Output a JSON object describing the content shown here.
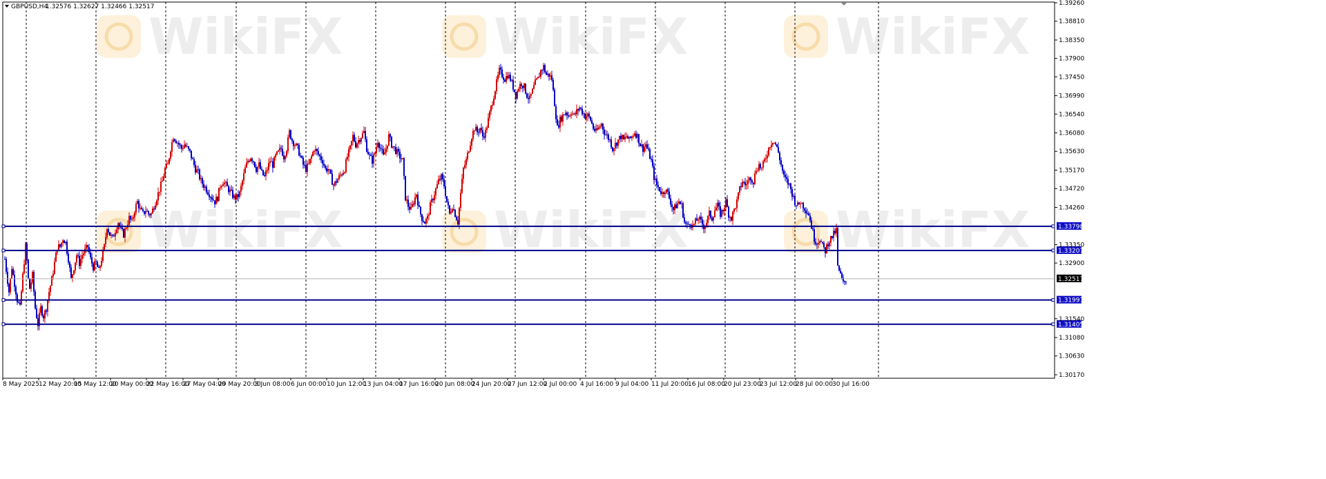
{
  "header": {
    "symbol_label": "GBPUSD,H4",
    "ohlc": "1.32576 1.32627 1.32466 1.32517"
  },
  "watermark": {
    "text": "WikiFX"
  },
  "colors": {
    "background": "#ffffff",
    "bull_candle": "#d40000",
    "bear_candle": "#0000c8",
    "level_line": "#00008b",
    "grid": "#000000",
    "current_price_tag": "#000000"
  },
  "chart_data": {
    "type": "candlestick",
    "symbol": "GBPUSD",
    "timeframe": "H4",
    "ylim": [
      1.3017,
      1.3926
    ],
    "price_ticks": [
      "1.39260",
      "1.38810",
      "1.38350",
      "1.37900",
      "1.37450",
      "1.36990",
      "1.36540",
      "1.36080",
      "1.35630",
      "1.35170",
      "1.34720",
      "1.34260",
      "1.33350",
      "1.32900",
      "1.31540",
      "1.31080",
      "1.30630",
      "1.30170"
    ],
    "time_labels": [
      "8 May 2025",
      "12 May 20:00",
      "15 May 12:00",
      "20 May 00:00",
      "22 May 16:00",
      "27 May 04:00",
      "29 May 20:00",
      "3 Jun 08:00",
      "6 Jun 00:00",
      "10 Jun 12:00",
      "13 Jun 04:00",
      "17 Jun 16:00",
      "20 Jun 08:00",
      "24 Jun 20:00",
      "27 Jun 12:00",
      "2 Jul 00:00",
      "4 Jul 16:00",
      "9 Jul 04:00",
      "11 Jul 20:00",
      "16 Jul 08:00",
      "20 Jul 23:00",
      "23 Jul 12:00",
      "28 Jul 00:00",
      "30 Jul 16:00"
    ],
    "horizontal_levels": [
      {
        "value": 1.33798,
        "label": "1.33798"
      },
      {
        "value": 1.33207,
        "label": "1.33207"
      },
      {
        "value": 1.31997,
        "label": "1.31997"
      },
      {
        "value": 1.31405,
        "label": "1.31405"
      }
    ],
    "current_price": {
      "value": 1.32517,
      "label": "1.32517"
    },
    "close_path": [
      [
        0,
        1.33
      ],
      [
        6,
        1.322
      ],
      [
        10,
        1.328
      ],
      [
        14,
        1.324
      ],
      [
        18,
        1.32
      ],
      [
        22,
        1.318
      ],
      [
        26,
        1.326
      ],
      [
        30,
        1.333
      ],
      [
        33,
        1.328
      ],
      [
        35,
        1.322
      ],
      [
        40,
        1.326
      ],
      [
        44,
        1.318
      ],
      [
        48,
        1.314
      ],
      [
        52,
        1.318
      ],
      [
        56,
        1.316
      ],
      [
        60,
        1.318
      ],
      [
        64,
        1.322
      ],
      [
        68,
        1.325
      ],
      [
        72,
        1.329
      ],
      [
        76,
        1.333
      ],
      [
        80,
        1.333
      ],
      [
        84,
        1.335
      ],
      [
        88,
        1.334
      ],
      [
        92,
        1.33
      ],
      [
        96,
        1.325
      ],
      [
        100,
        1.328
      ],
      [
        104,
        1.331
      ],
      [
        108,
        1.329
      ],
      [
        112,
        1.331
      ],
      [
        116,
        1.332
      ],
      [
        120,
        1.333
      ],
      [
        124,
        1.33
      ],
      [
        128,
        1.328
      ],
      [
        132,
        1.329
      ],
      [
        136,
        1.327
      ],
      [
        140,
        1.33
      ],
      [
        144,
        1.333
      ],
      [
        148,
        1.338
      ],
      [
        152,
        1.336
      ],
      [
        156,
        1.335
      ],
      [
        160,
        1.337
      ],
      [
        164,
        1.339
      ],
      [
        168,
        1.337
      ],
      [
        172,
        1.336
      ],
      [
        176,
        1.338
      ],
      [
        180,
        1.34
      ],
      [
        184,
        1.339
      ],
      [
        188,
        1.342
      ],
      [
        192,
        1.344
      ],
      [
        196,
        1.342
      ],
      [
        200,
        1.341
      ],
      [
        204,
        1.342
      ],
      [
        208,
        1.341
      ],
      [
        212,
        1.341
      ],
      [
        216,
        1.343
      ],
      [
        220,
        1.345
      ],
      [
        224,
        1.347
      ],
      [
        228,
        1.349
      ],
      [
        232,
        1.352
      ],
      [
        236,
        1.353
      ],
      [
        240,
        1.357
      ],
      [
        244,
        1.36
      ],
      [
        248,
        1.359
      ],
      [
        252,
        1.358
      ],
      [
        256,
        1.357
      ],
      [
        260,
        1.358
      ],
      [
        264,
        1.357
      ],
      [
        268,
        1.356
      ],
      [
        272,
        1.354
      ],
      [
        276,
        1.352
      ],
      [
        280,
        1.351
      ],
      [
        284,
        1.349
      ],
      [
        288,
        1.348
      ],
      [
        292,
        1.347
      ],
      [
        296,
        1.346
      ],
      [
        300,
        1.345
      ],
      [
        304,
        1.344
      ],
      [
        308,
        1.345
      ],
      [
        312,
        1.348
      ],
      [
        316,
        1.349
      ],
      [
        320,
        1.348
      ],
      [
        324,
        1.347
      ],
      [
        328,
        1.346
      ],
      [
        332,
        1.345
      ],
      [
        336,
        1.345
      ],
      [
        340,
        1.346
      ],
      [
        344,
        1.349
      ],
      [
        348,
        1.352
      ],
      [
        352,
        1.354
      ],
      [
        356,
        1.355
      ],
      [
        360,
        1.354
      ],
      [
        364,
        1.352
      ],
      [
        368,
        1.353
      ],
      [
        372,
        1.351
      ],
      [
        376,
        1.35
      ],
      [
        380,
        1.352
      ],
      [
        384,
        1.354
      ],
      [
        388,
        1.353
      ],
      [
        392,
        1.355
      ],
      [
        396,
        1.356
      ],
      [
        400,
        1.357
      ],
      [
        404,
        1.355
      ],
      [
        408,
        1.357
      ],
      [
        412,
        1.361
      ],
      [
        416,
        1.359
      ],
      [
        420,
        1.358
      ],
      [
        424,
        1.357
      ],
      [
        428,
        1.355
      ],
      [
        432,
        1.353
      ],
      [
        436,
        1.352
      ],
      [
        440,
        1.353
      ],
      [
        444,
        1.355
      ],
      [
        448,
        1.357
      ],
      [
        452,
        1.356
      ],
      [
        456,
        1.355
      ],
      [
        460,
        1.354
      ],
      [
        464,
        1.352
      ],
      [
        468,
        1.352
      ],
      [
        472,
        1.35
      ],
      [
        476,
        1.348
      ],
      [
        480,
        1.349
      ],
      [
        484,
        1.35
      ],
      [
        488,
        1.351
      ],
      [
        492,
        1.352
      ],
      [
        496,
        1.355
      ],
      [
        500,
        1.357
      ],
      [
        504,
        1.36
      ],
      [
        508,
        1.358
      ],
      [
        512,
        1.359
      ],
      [
        516,
        1.36
      ],
      [
        520,
        1.361
      ],
      [
        524,
        1.357
      ],
      [
        528,
        1.355
      ],
      [
        532,
        1.354
      ],
      [
        536,
        1.356
      ],
      [
        540,
        1.359
      ],
      [
        544,
        1.357
      ],
      [
        548,
        1.355
      ],
      [
        552,
        1.357
      ],
      [
        556,
        1.36
      ],
      [
        560,
        1.358
      ],
      [
        564,
        1.357
      ],
      [
        568,
        1.356
      ],
      [
        572,
        1.355
      ],
      [
        576,
        1.354
      ],
      [
        580,
        1.345
      ],
      [
        584,
        1.343
      ],
      [
        588,
        1.342
      ],
      [
        592,
        1.344
      ],
      [
        596,
        1.346
      ],
      [
        600,
        1.342
      ],
      [
        604,
        1.34
      ],
      [
        608,
        1.339
      ],
      [
        612,
        1.34
      ],
      [
        616,
        1.343
      ],
      [
        620,
        1.345
      ],
      [
        624,
        1.347
      ],
      [
        628,
        1.349
      ],
      [
        632,
        1.35
      ],
      [
        636,
        1.348
      ],
      [
        640,
        1.344
      ],
      [
        644,
        1.341
      ],
      [
        648,
        1.343
      ],
      [
        652,
        1.341
      ],
      [
        656,
        1.339
      ],
      [
        660,
        1.346
      ],
      [
        664,
        1.352
      ],
      [
        668,
        1.354
      ],
      [
        672,
        1.357
      ],
      [
        676,
        1.36
      ],
      [
        680,
        1.362
      ],
      [
        684,
        1.361
      ],
      [
        688,
        1.362
      ],
      [
        692,
        1.36
      ],
      [
        696,
        1.361
      ],
      [
        700,
        1.364
      ],
      [
        704,
        1.367
      ],
      [
        708,
        1.37
      ],
      [
        712,
        1.373
      ],
      [
        716,
        1.376
      ],
      [
        720,
        1.375
      ],
      [
        724,
        1.374
      ],
      [
        728,
        1.375
      ],
      [
        732,
        1.374
      ],
      [
        736,
        1.372
      ],
      [
        740,
        1.37
      ],
      [
        744,
        1.372
      ],
      [
        748,
        1.373
      ],
      [
        752,
        1.372
      ],
      [
        756,
        1.37
      ],
      [
        760,
        1.369
      ],
      [
        764,
        1.371
      ],
      [
        768,
        1.373
      ],
      [
        772,
        1.374
      ],
      [
        776,
        1.376
      ],
      [
        780,
        1.377
      ],
      [
        784,
        1.375
      ],
      [
        788,
        1.375
      ],
      [
        792,
        1.374
      ],
      [
        796,
        1.368
      ],
      [
        800,
        1.362
      ],
      [
        804,
        1.364
      ],
      [
        808,
        1.365
      ],
      [
        812,
        1.366
      ],
      [
        816,
        1.365
      ],
      [
        820,
        1.366
      ],
      [
        824,
        1.365
      ],
      [
        828,
        1.366
      ],
      [
        832,
        1.367
      ],
      [
        836,
        1.366
      ],
      [
        840,
        1.365
      ],
      [
        844,
        1.365
      ],
      [
        848,
        1.364
      ],
      [
        852,
        1.362
      ],
      [
        856,
        1.361
      ],
      [
        860,
        1.362
      ],
      [
        864,
        1.363
      ],
      [
        868,
        1.361
      ],
      [
        872,
        1.36
      ],
      [
        876,
        1.359
      ],
      [
        880,
        1.357
      ],
      [
        884,
        1.358
      ],
      [
        888,
        1.359
      ],
      [
        892,
        1.36
      ],
      [
        896,
        1.359
      ],
      [
        900,
        1.36
      ],
      [
        904,
        1.359
      ],
      [
        908,
        1.36
      ],
      [
        912,
        1.361
      ],
      [
        916,
        1.36
      ],
      [
        920,
        1.358
      ],
      [
        924,
        1.357
      ],
      [
        928,
        1.358
      ],
      [
        932,
        1.356
      ],
      [
        936,
        1.354
      ],
      [
        940,
        1.35
      ],
      [
        944,
        1.348
      ],
      [
        948,
        1.347
      ],
      [
        952,
        1.346
      ],
      [
        956,
        1.347
      ],
      [
        960,
        1.346
      ],
      [
        964,
        1.344
      ],
      [
        968,
        1.342
      ],
      [
        972,
        1.343
      ],
      [
        976,
        1.344
      ],
      [
        980,
        1.343
      ],
      [
        984,
        1.339
      ],
      [
        988,
        1.338
      ],
      [
        992,
        1.339
      ],
      [
        996,
        1.338
      ],
      [
        1000,
        1.339
      ],
      [
        1004,
        1.34
      ],
      [
        1008,
        1.339
      ],
      [
        1012,
        1.338
      ],
      [
        1016,
        1.339
      ],
      [
        1020,
        1.341
      ],
      [
        1024,
        1.34
      ],
      [
        1028,
        1.342
      ],
      [
        1032,
        1.343
      ],
      [
        1036,
        1.341
      ],
      [
        1040,
        1.342
      ],
      [
        1044,
        1.344
      ],
      [
        1048,
        1.341
      ],
      [
        1052,
        1.34
      ],
      [
        1056,
        1.342
      ],
      [
        1060,
        1.344
      ],
      [
        1064,
        1.347
      ],
      [
        1068,
        1.349
      ],
      [
        1072,
        1.348
      ],
      [
        1076,
        1.349
      ],
      [
        1080,
        1.35
      ],
      [
        1084,
        1.349
      ],
      [
        1088,
        1.352
      ],
      [
        1092,
        1.353
      ],
      [
        1096,
        1.352
      ],
      [
        1100,
        1.354
      ],
      [
        1104,
        1.356
      ],
      [
        1108,
        1.358
      ],
      [
        1112,
        1.359
      ],
      [
        1116,
        1.358
      ],
      [
        1120,
        1.356
      ],
      [
        1124,
        1.353
      ],
      [
        1128,
        1.35
      ],
      [
        1132,
        1.349
      ],
      [
        1136,
        1.348
      ],
      [
        1140,
        1.346
      ],
      [
        1144,
        1.344
      ],
      [
        1148,
        1.343
      ],
      [
        1152,
        1.344
      ],
      [
        1156,
        1.343
      ],
      [
        1160,
        1.342
      ],
      [
        1164,
        1.341
      ],
      [
        1168,
        1.338
      ],
      [
        1172,
        1.335
      ],
      [
        1176,
        1.334
      ],
      [
        1180,
        1.335
      ],
      [
        1184,
        1.333
      ],
      [
        1188,
        1.332
      ],
      [
        1192,
        1.334
      ],
      [
        1196,
        1.335
      ],
      [
        1200,
        1.336
      ],
      [
        1204,
        1.337
      ],
      [
        1206,
        1.328
      ],
      [
        1210,
        1.326
      ],
      [
        1214,
        1.324
      ],
      [
        1218,
        1.325
      ]
    ]
  }
}
